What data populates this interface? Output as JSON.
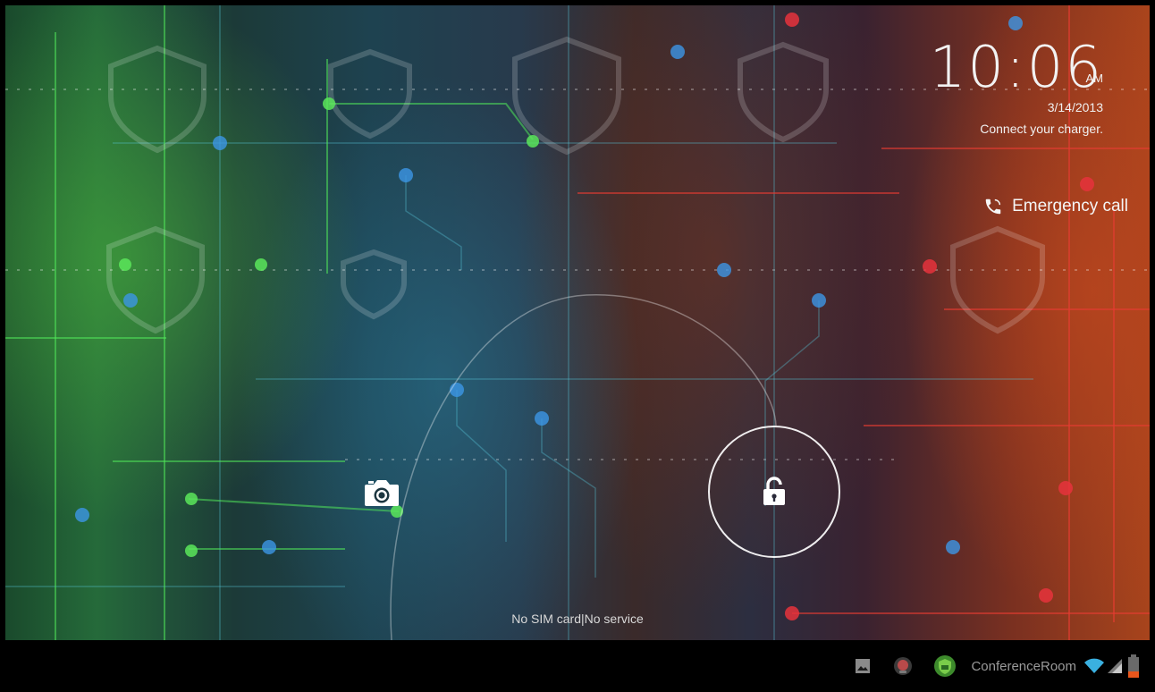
{
  "lockscreen": {
    "clock_time": "10:06",
    "clock_ampm": "AM",
    "date": "3/14/2013",
    "battery_message": "Connect your charger.",
    "emergency_call_label": "Emergency call",
    "carrier_text": "No SIM card|No service",
    "icons": {
      "camera": "camera-icon",
      "unlock": "unlock-padlock-icon",
      "phone": "phone-icon"
    }
  },
  "status_bar": {
    "wifi_network_name": "ConferenceRoom",
    "icons": [
      "gallery-image-icon",
      "app-badge-icon",
      "shield-app-icon",
      "wifi-icon",
      "signal-icon",
      "battery-icon"
    ],
    "battery_color": "#e8561c"
  },
  "colors": {
    "ring": "#ffffff",
    "text": "#f2f2f2",
    "status_text": "#9a9a9a"
  }
}
